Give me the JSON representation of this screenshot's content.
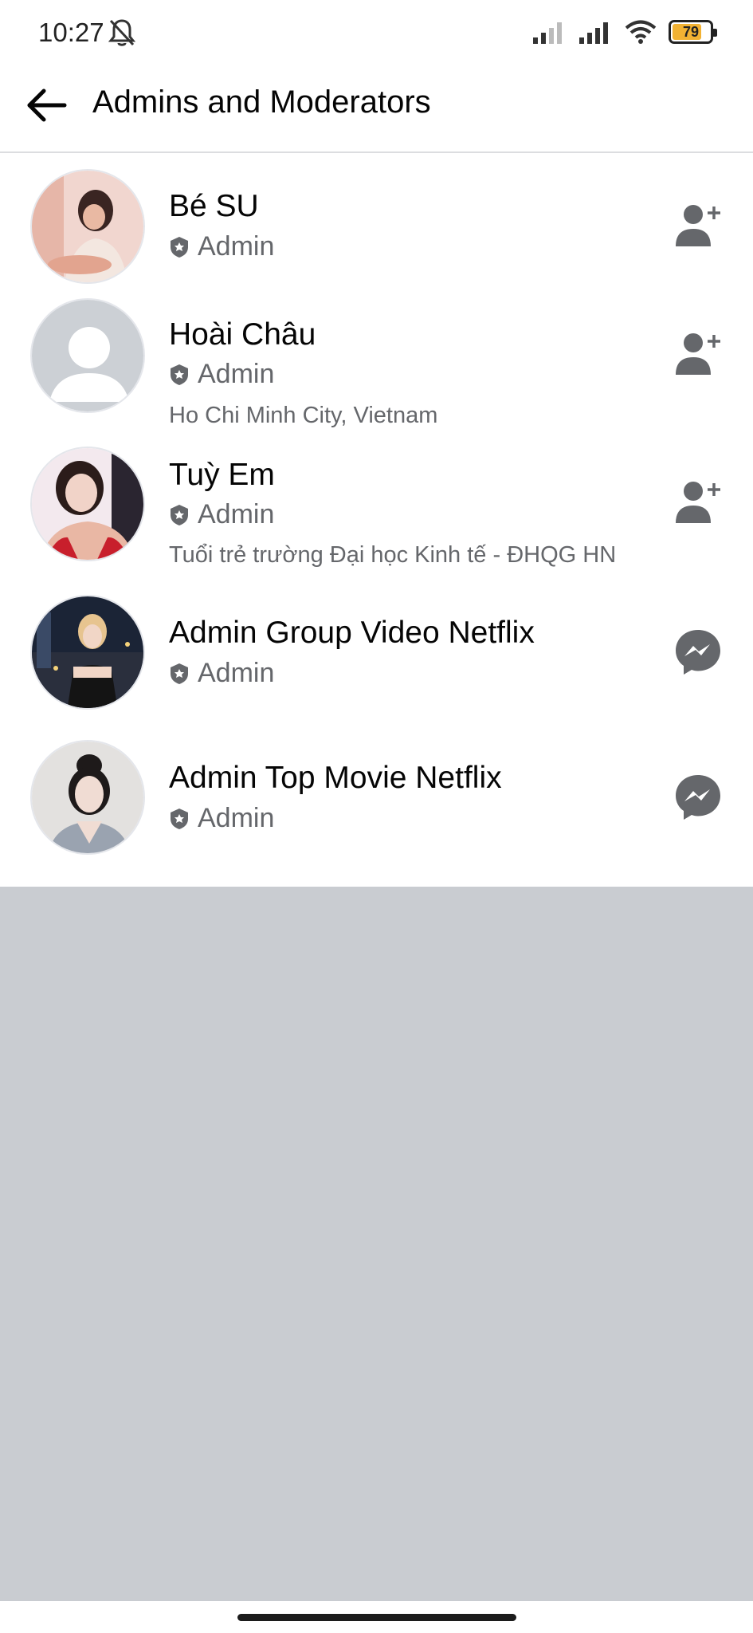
{
  "status_bar": {
    "time": "10:27",
    "battery_level": "79",
    "battery_percent": 79,
    "icons": [
      "bell-off-icon",
      "signal-weak-icon",
      "signal-icon",
      "wifi-icon",
      "battery-icon"
    ]
  },
  "header": {
    "title": "Admins and Moderators",
    "back_icon": "arrow-left-icon"
  },
  "members": [
    {
      "name": "Bé SU",
      "role": "Admin",
      "detail": "",
      "action_icon": "add-friend-icon",
      "avatar": "photo"
    },
    {
      "name": "Hoài Châu",
      "role": "Admin",
      "detail": "Ho Chi Minh City, Vietnam",
      "action_icon": "add-friend-icon",
      "avatar": "default-silhouette"
    },
    {
      "name": "Tuỳ Em",
      "role": "Admin",
      "detail": "Tuổi trẻ trường Đại học Kinh tế - ĐHQG HN",
      "action_icon": "add-friend-icon",
      "avatar": "photo"
    },
    {
      "name": "Admin Group Video Netflix",
      "role": "Admin",
      "detail": "",
      "action_icon": "messenger-icon",
      "avatar": "photo"
    },
    {
      "name": "Admin Top Movie Netflix",
      "role": "Admin",
      "detail": "",
      "action_icon": "messenger-icon",
      "avatar": "photo"
    }
  ],
  "colors": {
    "background": "#c9ccd1",
    "surface": "#ffffff",
    "text_primary": "#050505",
    "text_secondary": "#65676b",
    "icon_gray": "#65676b",
    "battery_fill": "#f2b233"
  }
}
